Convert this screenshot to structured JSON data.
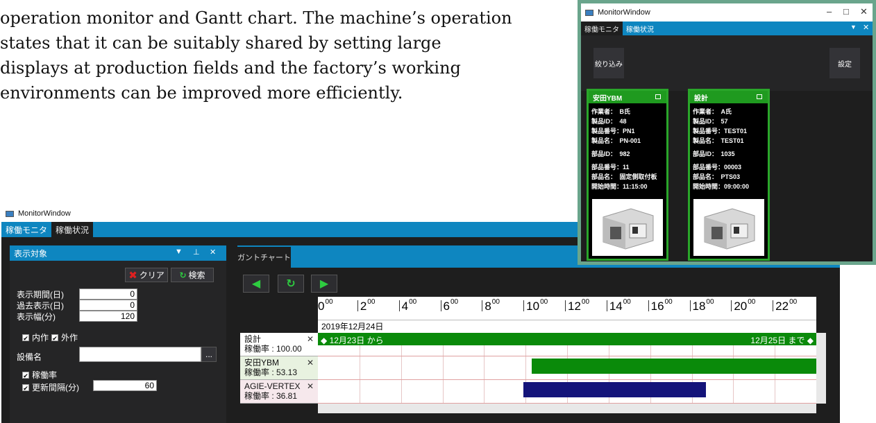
{
  "paper": {
    "lines": [
      "operation monitor and Gantt chart.  The machine’s operation",
      "states that it can be suitably shared by setting large",
      "displays at production fields and the factory’s working",
      "environments can be improved more efficiently."
    ]
  },
  "main_window": {
    "title": "MonitorWindow",
    "tabs": [
      "稼働モニタ",
      "稼働状況"
    ],
    "left_panel": {
      "title": "表示対象",
      "clear_label": "クリア",
      "search_label": "検索",
      "fields": [
        {
          "label": "表示期間(日)",
          "value": "0"
        },
        {
          "label": "過去表示(日)",
          "value": "0"
        },
        {
          "label": "表示幅(分)",
          "value": "120"
        }
      ],
      "check_internal": "内作",
      "check_external": "外作",
      "equipment_label": "設備名",
      "equipment_value": "",
      "browse_label": "...",
      "check_rate": "稼働率",
      "check_interval": "更新間隔(分)",
      "interval_value": "60"
    },
    "gantt": {
      "tab_label": "ガントチャート",
      "hours": [
        "0",
        "2",
        "4",
        "6",
        "8",
        "10",
        "12",
        "14",
        "16",
        "18",
        "20",
        "22"
      ],
      "minutes": "00",
      "date_label": "2019年12月24日",
      "rows": [
        {
          "name": "設計",
          "rate": "稼働率 : 100.00",
          "bar_color": "#0a8a0a",
          "bar_start": 0,
          "bar_end": 24,
          "from_label": "12月23日 から",
          "to_label": "12月25日 まで"
        },
        {
          "name": "安田YBM",
          "rate": "稼働率 : 53.13",
          "bar_color": "#0a8a0a",
          "bar_start": 10.3,
          "bar_end": 24
        },
        {
          "name": "AGIE-VERTEX",
          "rate": "稼働率 : 36.81",
          "bar_color": "#14147a",
          "bar_start": 9.9,
          "bar_end": 18.7
        }
      ]
    }
  },
  "monitor_window": {
    "title": "MonitorWindow",
    "tabs": [
      "稼働モニタ",
      "稼働状況"
    ],
    "filter_label": "絞り込み",
    "settings_label": "設定",
    "cards": [
      {
        "name": "安田YBM",
        "lines": [
          "作業者：　B氏",
          "製品ID：　48",
          "製品番号：PN1",
          "製品名：　PN-001",
          "部品ID：　982",
          "部品番号：11",
          "部品名：　固定側取付板",
          "開始時間：11:15:00"
        ]
      },
      {
        "name": "設計",
        "lines": [
          "作業者：　A氏",
          "製品ID：　57",
          "製品番号：TEST01",
          "製品名：　TEST01",
          "部品ID：　1035",
          "部品番号：00003",
          "部品名：　PTS03",
          "開始時間：09:00:00"
        ]
      }
    ]
  }
}
